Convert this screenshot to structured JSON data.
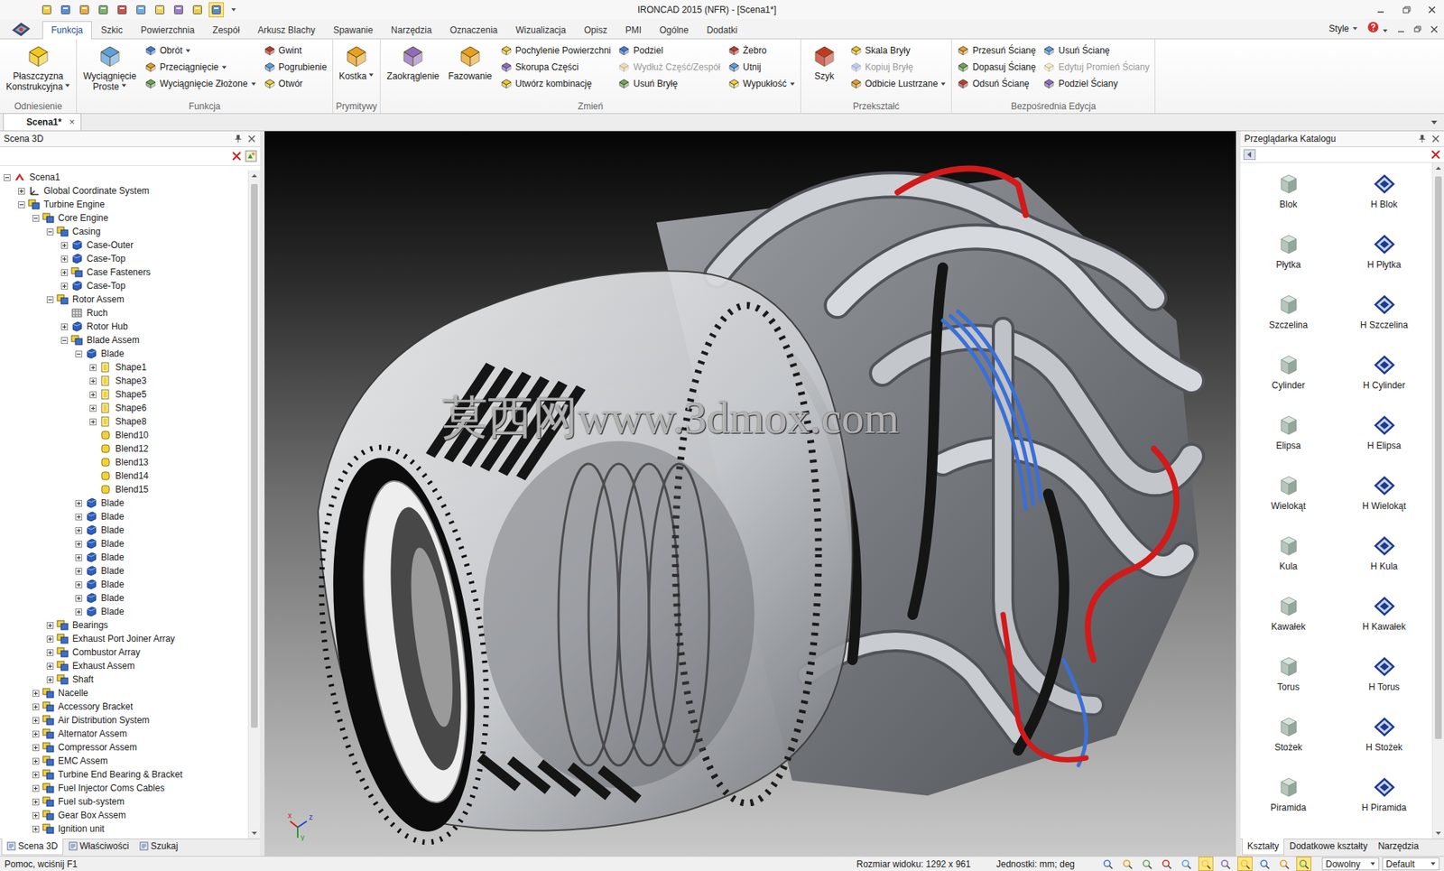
{
  "window": {
    "title": "IRONCAD 2015 (NFR) - [Scena1*]"
  },
  "quick_access_tools": [
    {
      "active": false
    },
    {
      "active": false
    },
    {
      "active": false
    },
    {
      "active": false
    },
    {
      "active": false
    },
    {
      "active": false
    },
    {
      "active": false
    },
    {
      "active": false
    },
    {
      "active": false
    },
    {
      "active": true
    }
  ],
  "ribbon": {
    "tabs": [
      {
        "label": "Funkcja",
        "selected": true
      },
      {
        "label": "Szkic",
        "selected": false
      },
      {
        "label": "Powierzchnia",
        "selected": false
      },
      {
        "label": "Zespół",
        "selected": false
      },
      {
        "label": "Arkusz Blachy",
        "selected": false
      },
      {
        "label": "Spawanie",
        "selected": false
      },
      {
        "label": "Narzędzia",
        "selected": false
      },
      {
        "label": "Oznaczenia",
        "selected": false
      },
      {
        "label": "Wizualizacja",
        "selected": false
      },
      {
        "label": "Opisz",
        "selected": false
      },
      {
        "label": "PMI",
        "selected": false
      },
      {
        "label": "Ogólne",
        "selected": false
      },
      {
        "label": "Dodatki",
        "selected": false
      }
    ],
    "style_label": "Style",
    "groups": [
      {
        "label": "Odniesienie",
        "items": [
          {
            "kind": "large",
            "lines": [
              "Płaszczyzna",
              "Konstrukcyjna"
            ],
            "dropdown": true
          }
        ]
      },
      {
        "label": "Funkcja",
        "items": [
          {
            "kind": "large",
            "lines": [
              "Wyciągnięcie",
              "Proste"
            ],
            "dropdown": true
          },
          {
            "kind": "column",
            "buttons": [
              {
                "label": "Obrót",
                "dropdown": true,
                "disabled": false
              },
              {
                "label": "Przeciągnięcie",
                "dropdown": true,
                "disabled": false
              },
              {
                "label": "Wyciągnięcie Złożone",
                "dropdown": true,
                "disabled": false
              }
            ]
          },
          {
            "kind": "column",
            "buttons": [
              {
                "label": "Gwint",
                "dropdown": false,
                "disabled": false
              },
              {
                "label": "Pogrubienie",
                "dropdown": false,
                "disabled": false
              },
              {
                "label": "Otwór",
                "dropdown": false,
                "disabled": false
              }
            ]
          }
        ]
      },
      {
        "label": "Prymitywy",
        "items": [
          {
            "kind": "large",
            "lines": [
              "Kostka"
            ],
            "dropdown": true
          }
        ]
      },
      {
        "label": "Zmień",
        "items": [
          {
            "kind": "large",
            "lines": [
              "Zaokrąglenie"
            ],
            "dropdown": false
          },
          {
            "kind": "large",
            "lines": [
              "Fazowanie"
            ],
            "dropdown": false
          },
          {
            "kind": "column",
            "buttons": [
              {
                "label": "Pochylenie Powierzchni",
                "dropdown": false,
                "disabled": false
              },
              {
                "label": "Skorupa Części",
                "dropdown": false,
                "disabled": false
              },
              {
                "label": "Utwórz kombinację",
                "dropdown": false,
                "disabled": false
              }
            ]
          },
          {
            "kind": "column",
            "buttons": [
              {
                "label": "Podziel",
                "dropdown": false,
                "disabled": false
              },
              {
                "label": "Wydłuż Część/Zespół",
                "dropdown": false,
                "disabled": true
              },
              {
                "label": "Usuń Bryłę",
                "dropdown": false,
                "disabled": false
              }
            ]
          },
          {
            "kind": "column",
            "buttons": [
              {
                "label": "Żebro",
                "dropdown": false,
                "disabled": false
              },
              {
                "label": "Utnij",
                "dropdown": false,
                "disabled": false
              },
              {
                "label": "Wypukłość",
                "dropdown": true,
                "disabled": false
              }
            ]
          }
        ]
      },
      {
        "label": "Przekształć",
        "items": [
          {
            "kind": "large",
            "lines": [
              "Szyk"
            ],
            "dropdown": false
          },
          {
            "kind": "column",
            "buttons": [
              {
                "label": "Skala Bryły",
                "dropdown": false,
                "disabled": false
              },
              {
                "label": "Kopiuj Bryłę",
                "dropdown": false,
                "disabled": true
              },
              {
                "label": "Odbicie Lustrzane",
                "dropdown": true,
                "disabled": false
              }
            ]
          }
        ]
      },
      {
        "label": "Bezpośrednia Edycja",
        "items": [
          {
            "kind": "column",
            "buttons": [
              {
                "label": "Przesuń Ścianę",
                "dropdown": false,
                "disabled": false
              },
              {
                "label": "Dopasuj Ścianę",
                "dropdown": false,
                "disabled": false
              },
              {
                "label": "Odsuń Ścianę",
                "dropdown": false,
                "disabled": false
              }
            ]
          },
          {
            "kind": "column",
            "buttons": [
              {
                "label": "Usuń Ścianę",
                "dropdown": false,
                "disabled": false
              },
              {
                "label": "Edytuj Promień Ściany",
                "dropdown": false,
                "disabled": true
              },
              {
                "label": "Podziel Ściany",
                "dropdown": false,
                "disabled": false
              }
            ]
          }
        ]
      }
    ]
  },
  "document_tabs": [
    {
      "label": "Scena1*",
      "selected": true,
      "close": "×"
    }
  ],
  "scene_panel": {
    "title": "Scena 3D",
    "tree": [
      {
        "label": "Scena1",
        "level": 0,
        "expandable": true,
        "expanded": true,
        "kind": "scene"
      },
      {
        "label": "Global Coordinate System",
        "level": 1,
        "expandable": true,
        "expanded": false,
        "kind": "coords"
      },
      {
        "label": "Turbine Engine",
        "level": 1,
        "expandable": true,
        "expanded": true,
        "kind": "assembly"
      },
      {
        "label": "Core Engine",
        "level": 2,
        "expandable": true,
        "expanded": true,
        "kind": "assembly"
      },
      {
        "label": "Casing",
        "level": 3,
        "expandable": true,
        "expanded": true,
        "kind": "assembly"
      },
      {
        "label": "Case-Outer",
        "level": 4,
        "expandable": true,
        "expanded": false,
        "kind": "part"
      },
      {
        "label": "Case-Top",
        "level": 4,
        "expandable": true,
        "expanded": false,
        "kind": "part"
      },
      {
        "label": "Case Fasteners",
        "level": 4,
        "expandable": true,
        "expanded": false,
        "kind": "assembly"
      },
      {
        "label": "Case-Top",
        "level": 4,
        "expandable": true,
        "expanded": false,
        "kind": "part"
      },
      {
        "label": "Rotor Assem",
        "level": 3,
        "expandable": true,
        "expanded": true,
        "kind": "assembly"
      },
      {
        "label": "Ruch",
        "level": 4,
        "expandable": false,
        "expanded": false,
        "kind": "motion"
      },
      {
        "label": "Rotor Hub",
        "level": 4,
        "expandable": true,
        "expanded": false,
        "kind": "part"
      },
      {
        "label": "Blade Assem",
        "level": 4,
        "expandable": true,
        "expanded": true,
        "kind": "assembly"
      },
      {
        "label": "Blade",
        "level": 5,
        "expandable": true,
        "expanded": true,
        "kind": "part"
      },
      {
        "label": "Shape1",
        "level": 6,
        "expandable": true,
        "expanded": false,
        "kind": "shape"
      },
      {
        "label": "Shape3",
        "level": 6,
        "expandable": true,
        "expanded": false,
        "kind": "shape"
      },
      {
        "label": "Shape5",
        "level": 6,
        "expandable": true,
        "expanded": false,
        "kind": "shape"
      },
      {
        "label": "Shape6",
        "level": 6,
        "expandable": true,
        "expanded": false,
        "kind": "shape"
      },
      {
        "label": "Shape8",
        "level": 6,
        "expandable": true,
        "expanded": false,
        "kind": "shape"
      },
      {
        "label": "Blend10",
        "level": 6,
        "expandable": false,
        "expanded": false,
        "kind": "blend"
      },
      {
        "label": "Blend12",
        "level": 6,
        "expandable": false,
        "expanded": false,
        "kind": "blend"
      },
      {
        "label": "Blend13",
        "level": 6,
        "expandable": false,
        "expanded": false,
        "kind": "blend"
      },
      {
        "label": "Blend14",
        "level": 6,
        "expandable": false,
        "expanded": false,
        "kind": "blend"
      },
      {
        "label": "Blend15",
        "level": 6,
        "expandable": false,
        "expanded": false,
        "kind": "blend"
      },
      {
        "label": "Blade",
        "level": 5,
        "expandable": true,
        "expanded": false,
        "kind": "part"
      },
      {
        "label": "Blade",
        "level": 5,
        "expandable": true,
        "expanded": false,
        "kind": "part"
      },
      {
        "label": "Blade",
        "level": 5,
        "expandable": true,
        "expanded": false,
        "kind": "part"
      },
      {
        "label": "Blade",
        "level": 5,
        "expandable": true,
        "expanded": false,
        "kind": "part"
      },
      {
        "label": "Blade",
        "level": 5,
        "expandable": true,
        "expanded": false,
        "kind": "part"
      },
      {
        "label": "Blade",
        "level": 5,
        "expandable": true,
        "expanded": false,
        "kind": "part"
      },
      {
        "label": "Blade",
        "level": 5,
        "expandable": true,
        "expanded": false,
        "kind": "part"
      },
      {
        "label": "Blade",
        "level": 5,
        "expandable": true,
        "expanded": false,
        "kind": "part"
      },
      {
        "label": "Blade",
        "level": 5,
        "expandable": true,
        "expanded": false,
        "kind": "part"
      },
      {
        "label": "Bearings",
        "level": 3,
        "expandable": true,
        "expanded": false,
        "kind": "assembly"
      },
      {
        "label": "Exhaust Port Joiner Array",
        "level": 3,
        "expandable": true,
        "expanded": false,
        "kind": "assembly"
      },
      {
        "label": "Combustor Array",
        "level": 3,
        "expandable": true,
        "expanded": false,
        "kind": "assembly"
      },
      {
        "label": "Exhaust Assem",
        "level": 3,
        "expandable": true,
        "expanded": false,
        "kind": "assembly"
      },
      {
        "label": "Shaft",
        "level": 3,
        "expandable": true,
        "expanded": false,
        "kind": "assembly"
      },
      {
        "label": "Nacelle",
        "level": 2,
        "expandable": true,
        "expanded": false,
        "kind": "assembly"
      },
      {
        "label": "Accessory Bracket",
        "level": 2,
        "expandable": true,
        "expanded": false,
        "kind": "assembly"
      },
      {
        "label": "Air Distribution System",
        "level": 2,
        "expandable": true,
        "expanded": false,
        "kind": "assembly"
      },
      {
        "label": "Alternator Assem",
        "level": 2,
        "expandable": true,
        "expanded": false,
        "kind": "assembly"
      },
      {
        "label": "Compressor Assem",
        "level": 2,
        "expandable": true,
        "expanded": false,
        "kind": "assembly"
      },
      {
        "label": "EMC Assem",
        "level": 2,
        "expandable": true,
        "expanded": false,
        "kind": "assembly"
      },
      {
        "label": "Turbine End Bearing & Bracket",
        "level": 2,
        "expandable": true,
        "expanded": false,
        "kind": "assembly"
      },
      {
        "label": "Fuel Injector Coms Cables",
        "level": 2,
        "expandable": true,
        "expanded": false,
        "kind": "assembly"
      },
      {
        "label": "Fuel sub-system",
        "level": 2,
        "expandable": true,
        "expanded": false,
        "kind": "assembly"
      },
      {
        "label": "Gear Box Assem",
        "level": 2,
        "expandable": true,
        "expanded": false,
        "kind": "assembly"
      },
      {
        "label": "Ignition unit",
        "level": 2,
        "expandable": true,
        "expanded": false,
        "kind": "assembly"
      }
    ],
    "bottom_tabs": [
      {
        "label": "Scena 3D",
        "selected": true
      },
      {
        "label": "Właściwości",
        "selected": false
      },
      {
        "label": "Szukaj",
        "selected": false
      }
    ]
  },
  "viewport": {
    "watermark": "莫西网www.3dmox.com",
    "axes": [
      "x",
      "y",
      "z"
    ]
  },
  "catalog": {
    "title": "Przeglądarka Katalogu",
    "items": [
      {
        "label": "Blok",
        "kind": "solid"
      },
      {
        "label": "H Blok",
        "kind": "hollow"
      },
      {
        "label": "Płytka",
        "kind": "solid"
      },
      {
        "label": "H Płytka",
        "kind": "hollow"
      },
      {
        "label": "Szczelina",
        "kind": "solid"
      },
      {
        "label": "H Szczelina",
        "kind": "hollow"
      },
      {
        "label": "Cylinder",
        "kind": "solid"
      },
      {
        "label": "H Cylinder",
        "kind": "hollow"
      },
      {
        "label": "Elipsa",
        "kind": "solid"
      },
      {
        "label": "H Elipsa",
        "kind": "hollow"
      },
      {
        "label": "Wielokąt",
        "kind": "solid"
      },
      {
        "label": "H Wielokąt",
        "kind": "hollow"
      },
      {
        "label": "Kula",
        "kind": "solid"
      },
      {
        "label": "H Kula",
        "kind": "hollow"
      },
      {
        "label": "Kawałek",
        "kind": "solid"
      },
      {
        "label": "H Kawałek",
        "kind": "hollow"
      },
      {
        "label": "Torus",
        "kind": "solid"
      },
      {
        "label": "H Torus",
        "kind": "hollow"
      },
      {
        "label": "Stożek",
        "kind": "solid"
      },
      {
        "label": "H Stożek",
        "kind": "hollow"
      },
      {
        "label": "Piramida",
        "kind": "solid"
      },
      {
        "label": "H Piramida",
        "kind": "hollow"
      }
    ],
    "bottom_tabs": [
      {
        "label": "Kształty",
        "selected": true
      },
      {
        "label": "Dodatkowe kształty",
        "selected": false
      },
      {
        "label": "Narzędzia",
        "selected": false
      }
    ]
  },
  "status_bar": {
    "help": "Pomoc, wciśnij F1",
    "view_size": "Rozmiar widoku: 1292 x 961",
    "units": "Jednostki: mm; deg",
    "tools": [
      {
        "active": false
      },
      {
        "active": false
      },
      {
        "active": false
      },
      {
        "active": false
      },
      {
        "active": false
      },
      {
        "active": true
      },
      {
        "active": false
      },
      {
        "active": true
      },
      {
        "active": false
      },
      {
        "active": false
      },
      {
        "active": true
      }
    ],
    "dropdowns": [
      "Dowolny",
      "Default"
    ]
  }
}
